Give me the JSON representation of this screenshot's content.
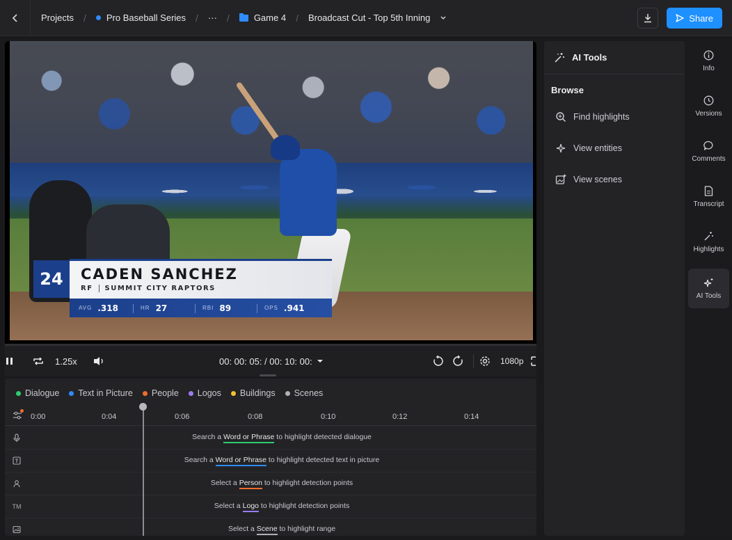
{
  "breadcrumb": {
    "items": [
      "Projects",
      "Pro Baseball Series",
      "···",
      "Game 4",
      "Broadcast Cut - Top 5th Inning"
    ]
  },
  "toolbar": {
    "share_label": "Share"
  },
  "lower_third": {
    "number": "24",
    "name": "CADEN SANCHEZ",
    "position": "RF",
    "team": "SUMMIT CITY RAPTORS",
    "stats": [
      {
        "key": "AVG",
        "value": ".318"
      },
      {
        "key": "HR",
        "value": "27"
      },
      {
        "key": "RBI",
        "value": "89"
      },
      {
        "key": "OPS",
        "value": ".941"
      }
    ]
  },
  "player": {
    "speed": "1.25x",
    "timecode": "00: 00: 05: / 00: 10: 00:",
    "quality": "1080p"
  },
  "timeline": {
    "legend": [
      {
        "label": "Dialogue",
        "color": "#2ecc71"
      },
      {
        "label": "Text in Picture",
        "color": "#2e8cff"
      },
      {
        "label": "People",
        "color": "#f26c2e"
      },
      {
        "label": "Logos",
        "color": "#9b7cf2"
      },
      {
        "label": "Buildings",
        "color": "#f2c12e"
      },
      {
        "label": "Scenes",
        "color": "#b0b0b5"
      }
    ],
    "ticks": [
      "0:00",
      "0:04",
      "0:06",
      "0:08",
      "0:10",
      "0:12",
      "0:14"
    ],
    "tracks": [
      {
        "pre": "Search a ",
        "kw": "Word or Phrase",
        "post": " to highlight detected dialogue",
        "color": "#2ecc71",
        "icon": "mic-icon"
      },
      {
        "pre": "Search a ",
        "kw": "Word or Phrase",
        "post": " to highlight detected text in picture",
        "color": "#2e8cff",
        "icon": "text-icon"
      },
      {
        "pre": "Select a ",
        "kw": "Person",
        "post": " to highlight detection points",
        "color": "#f26c2e",
        "icon": "person-icon"
      },
      {
        "pre": "Select a ",
        "kw": "Logo",
        "post": " to highlight detection points",
        "color": "#9b7cf2",
        "icon": "trademark-icon"
      },
      {
        "pre": "Select a ",
        "kw": "Scene",
        "post": " to highlight range",
        "color": "#b0b0b5",
        "icon": "image-icon"
      }
    ],
    "tm_glyph": "TM"
  },
  "ai_panel": {
    "title": "AI Tools",
    "browse_label": "Browse",
    "items": [
      "Find highlights",
      "View entities",
      "View scenes"
    ]
  },
  "rail": {
    "items": [
      "Info",
      "Versions",
      "Comments",
      "Transcript",
      "Highlights",
      "AI Tools"
    ],
    "active": "AI Tools"
  }
}
